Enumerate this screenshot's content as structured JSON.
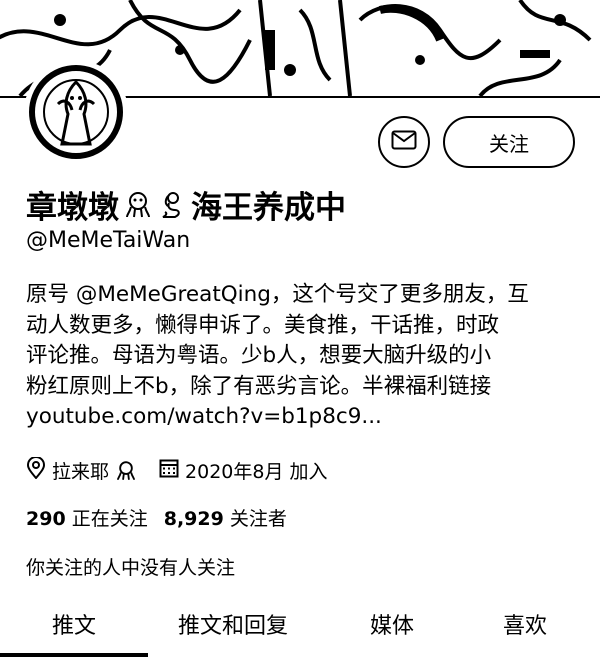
{
  "profile": {
    "display_name": "章墩墩",
    "display_name_suffix": "海王养成中",
    "handle": "@MeMeTaiWan",
    "bio_lines": [
      "原号 @MeMeGreatQing，这个号交了更多朋友，互",
      "动人数更多，懒得申诉了。美食推，干话推，时政",
      "评论推。母语为粤语。少b人，想要大脑升级的小",
      "粉红原则上不b，除了有恶劣言论。半裸福利链接",
      "youtube.com/watch?v=b1p8c9..."
    ],
    "location": "拉来耶",
    "joined": "2020年8月 加入",
    "following_count": "290",
    "following_label": "正在关注",
    "followers_count": "8,929",
    "followers_label": "关注者",
    "followers_you_know": "你关注的人中没有人关注"
  },
  "actions": {
    "message_icon": "envelope-icon",
    "follow_label": "关注"
  },
  "tabs": [
    {
      "label": "推文",
      "active": true
    },
    {
      "label": "推文和回复",
      "active": false
    },
    {
      "label": "媒体",
      "active": false
    },
    {
      "label": "喜欢",
      "active": false
    }
  ],
  "icons": {
    "location": "location-pin-icon",
    "calendar": "calendar-icon",
    "name_emoji_1": "octopus-emoji-icon",
    "name_emoji_2": "mermaid-emoji-icon",
    "location_emoji": "octopus-emoji-icon"
  }
}
